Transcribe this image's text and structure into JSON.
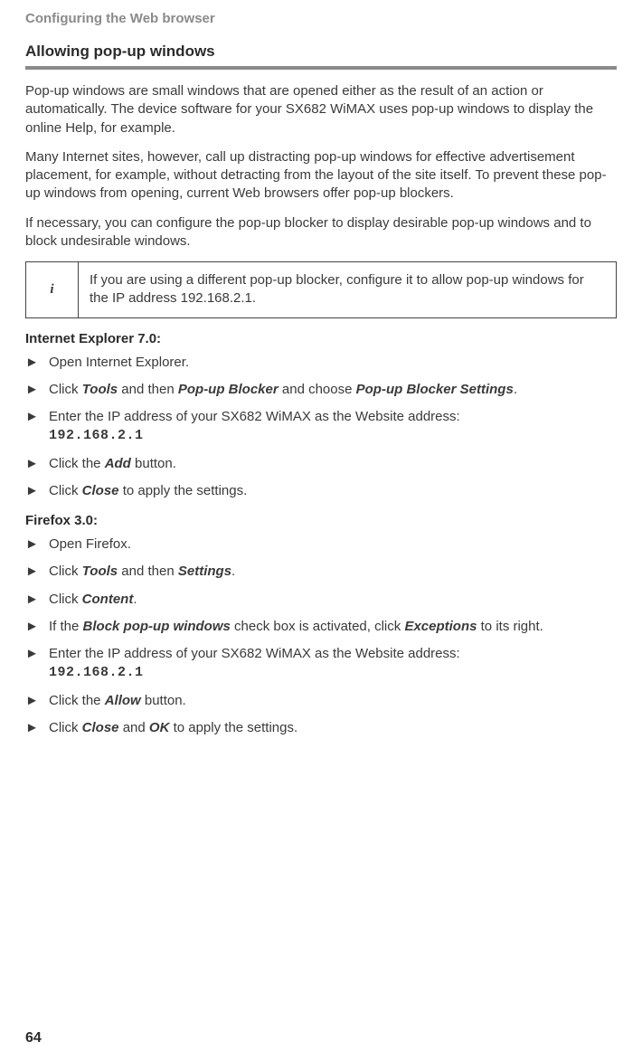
{
  "runningHead": "Configuring the Web browser",
  "sectionTitle": "Allowing pop-up windows",
  "para1": "Pop-up windows are small windows that are opened either as the result of an action or automatically. The device software for your SX682 WiMAX uses pop-up windows to display the online Help, for example.",
  "para2": "Many Internet sites, however, call up distracting pop-up windows for effective advertisement placement, for example, without detracting from the layout of the site itself. To prevent these pop-up windows from opening, current Web browsers offer pop-up blockers.",
  "para3": "If necessary, you can configure the pop-up blocker to display desirable pop-up windows and to block undesirable windows.",
  "info": {
    "icon": "i",
    "text": "If you are using a different pop-up blocker, configure it to allow pop-up windows for the IP address 192.168.2.1."
  },
  "ie": {
    "heading": "Internet Explorer 7.0:",
    "steps": {
      "s1": "Open Internet Explorer.",
      "s2a": "Click ",
      "s2b": "Tools",
      "s2c": " and then ",
      "s2d": "Pop-up Blocker",
      "s2e": " and choose ",
      "s2f": "Pop-up Blocker Settings",
      "s2g": ".",
      "s3a": "Enter the IP address of your SX682 WiMAX as the Website address:",
      "s3b": "192.168.2.1",
      "s4a": "Click the ",
      "s4b": "Add",
      "s4c": " button.",
      "s5a": "Click ",
      "s5b": "Close",
      "s5c": " to apply the settings."
    }
  },
  "ff": {
    "heading": "Firefox 3.0:",
    "steps": {
      "s1": "Open Firefox.",
      "s2a": "Click ",
      "s2b": "Tools",
      "s2c": " and then ",
      "s2d": "Settings",
      "s2e": ".",
      "s3a": "Click ",
      "s3b": "Content",
      "s3c": ".",
      "s4a": "If the ",
      "s4b": "Block pop-up windows",
      "s4c": " check box is activated, click ",
      "s4d": "Exceptions",
      "s4e": " to its right.",
      "s5a": "Enter the IP address of your SX682 WiMAX as the Website address:",
      "s5b": "192.168.2.1",
      "s6a": "Click the ",
      "s6b": "Allow",
      "s6c": " button.",
      "s7a": "Click ",
      "s7b": "Close",
      "s7c": " and ",
      "s7d": "OK",
      "s7e": " to apply the settings."
    }
  },
  "marker": "►",
  "pageNumber": "64"
}
